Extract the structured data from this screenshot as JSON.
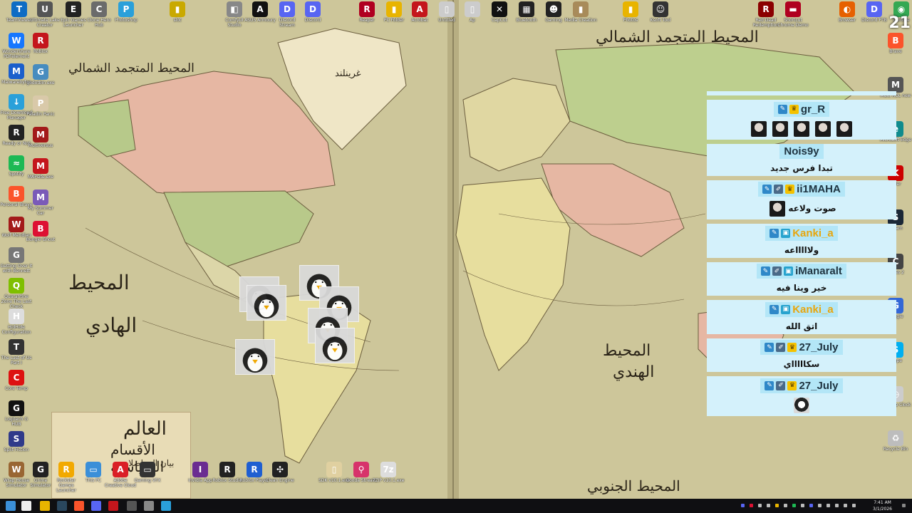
{
  "desktop": {
    "top_row": [
      {
        "label": "TeamViewer",
        "color": "#0e6cc4",
        "glyph": "T"
      },
      {
        "label": "Ultimate Lake Creator",
        "color": "#555555",
        "glyph": "U"
      },
      {
        "label": "Epic Games Launcher",
        "color": "#222222",
        "glyph": "E"
      },
      {
        "label": "Clone Hero Hub",
        "color": "#6b6b6b",
        "glyph": "C"
      },
      {
        "label": "Photoshop",
        "color": "#2aa0da",
        "glyph": "P"
      },
      {
        "label": "slot",
        "color": "#c9a900",
        "glyph": "▮"
      },
      {
        "label": "ComfyUI Studio",
        "color": "#888888",
        "glyph": "◧"
      },
      {
        "label": "ASUS Armoury",
        "color": "#111111",
        "glyph": "A"
      },
      {
        "label": "Discord Stream",
        "color": "#5865f2",
        "glyph": "D"
      },
      {
        "label": "Discord",
        "color": "#5865f2",
        "glyph": "D"
      },
      {
        "label": "Reaper",
        "color": "#b00020",
        "glyph": "R"
      },
      {
        "label": "PC Folder",
        "color": "#e8b400",
        "glyph": "▮"
      },
      {
        "label": "Acrobat",
        "color": "#c4161c",
        "glyph": "A"
      },
      {
        "label": "Untitled",
        "color": "#cccccc",
        "glyph": "▯"
      },
      {
        "label": "Ap",
        "color": "#cccccc",
        "glyph": "▯"
      },
      {
        "label": "CapCut",
        "color": "#111111",
        "glyph": "✕"
      },
      {
        "label": "Bluetooth",
        "color": "#222222",
        "glyph": "▦"
      },
      {
        "label": "Gaming",
        "color": "#222222",
        "glyph": "☻"
      },
      {
        "label": "Media Creation",
        "color": "#a88b5a",
        "glyph": "▮"
      },
      {
        "label": "Photos",
        "color": "#e8b400",
        "glyph": "▮"
      },
      {
        "label": "Ksoft Tool",
        "color": "#333333",
        "glyph": "☺"
      },
      {
        "label": "Red Dead Redemption",
        "color": "#8b0000",
        "glyph": "R"
      },
      {
        "label": "Shortcut Chrome Demo",
        "color": "#b00020",
        "glyph": "▬"
      },
      {
        "label": "Browser",
        "color": "#e66000",
        "glyph": "◐"
      },
      {
        "label": "Discord PTB",
        "color": "#5865f2",
        "glyph": "D"
      },
      {
        "label": "Chrome",
        "color": "#34a853",
        "glyph": "◉"
      }
    ],
    "left_col": [
      {
        "label": "Wondershare PDFelement",
        "color": "#1677ff",
        "glyph": "W"
      },
      {
        "label": "Malwarebytes",
        "color": "#1b5fcc",
        "glyph": "M"
      },
      {
        "label": "Free Download Manager",
        "color": "#2aa0da",
        "glyph": "↓"
      },
      {
        "label": "Ready or Not",
        "color": "#222222",
        "glyph": "R"
      },
      {
        "label": "Spotify",
        "color": "#1db954",
        "glyph": "≈"
      },
      {
        "label": "Personal Brave",
        "color": "#fb542b",
        "glyph": "B"
      },
      {
        "label": "Wolf Meridian",
        "color": "#a31a1a",
        "glyph": "W"
      },
      {
        "label": "Getting Over It with Bennett",
        "color": "#777777",
        "glyph": "G"
      },
      {
        "label": "Quarantine Zone The Last Check",
        "color": "#7fbf00",
        "glyph": "Q"
      },
      {
        "label": "HidHide Configuration",
        "color": "#dddddd",
        "glyph": "H"
      },
      {
        "label": "The Last of Us Part I",
        "color": "#333333",
        "glyph": "T"
      },
      {
        "label": "Core Temp",
        "color": "#d11",
        "glyph": "C"
      },
      {
        "label": "Logitech G HUB",
        "color": "#111111",
        "glyph": "G"
      },
      {
        "label": "Split Fiction",
        "color": "#2f3a8a",
        "glyph": "S"
      },
      {
        "label": "Wrap House Simulator",
        "color": "#996633",
        "glyph": "W"
      }
    ],
    "second_col": [
      {
        "label": "Roblox",
        "color": "#c4161c",
        "glyph": "R"
      },
      {
        "label": "godotbin.exe",
        "color": "#478cbf",
        "glyph": "G"
      },
      {
        "label": "Paladin Panic",
        "color": "#d9c9a9",
        "glyph": "P"
      },
      {
        "label": "Multiversus",
        "color": "#a31a1a",
        "glyph": "M"
      },
      {
        "label": "MAPsite.exe",
        "color": "#c4161c",
        "glyph": "M"
      },
      {
        "label": "My Summer Car",
        "color": "#7a5ab8",
        "glyph": "M"
      },
      {
        "label": "Bungie Ghost",
        "color": "#d13",
        "glyph": "B"
      }
    ],
    "bottom_row": [
      {
        "label": "Grime Simulator",
        "color": "#222222",
        "glyph": "G"
      },
      {
        "label": "Rockstar Games Launcher",
        "color": "#f2a900",
        "glyph": "R"
      },
      {
        "label": "This PC",
        "color": "#3b8fd8",
        "glyph": "▭"
      },
      {
        "label": "Adobe Creative Cloud",
        "color": "#da1f26",
        "glyph": "A"
      },
      {
        "label": "Gaming VFX",
        "color": "#333333",
        "glyph": "▭"
      },
      {
        "label": "Invidia App",
        "color": "#6a2c91",
        "glyph": "I"
      },
      {
        "label": "Roblox Studio",
        "color": "#222222",
        "glyph": "R"
      },
      {
        "label": "Roblox Player",
        "color": "#1f5fd1",
        "glyph": "R"
      },
      {
        "label": "Clean Engine",
        "color": "#222222",
        "glyph": "✣"
      },
      {
        "label": "SDK v10.1.exe",
        "color": "#e0d0a0",
        "glyph": "▯"
      },
      {
        "label": "Gooda Stream",
        "color": "#d7336b",
        "glyph": "⚲"
      },
      {
        "label": "7ZIP v10.1.exe",
        "color": "#dddddd",
        "glyph": "7z"
      }
    ],
    "right_col": [
      {
        "label": "Brave",
        "color": "#fb542b",
        "glyph": "B"
      },
      {
        "label": "Multi ROL new",
        "color": "#555555",
        "glyph": "M"
      },
      {
        "label": "Microsoft Edge",
        "color": "#0f8b8d",
        "glyph": "e"
      },
      {
        "label": "Killer",
        "color": "#cc0000",
        "glyph": "K"
      },
      {
        "label": "Steam",
        "color": "#1b2838",
        "glyph": "S"
      },
      {
        "label": "Chess 2",
        "color": "#444444",
        "glyph": "C"
      },
      {
        "label": "Google",
        "color": "#3367d6",
        "glyph": "G"
      },
      {
        "label": "Skype",
        "color": "#00aff0",
        "glyph": "S"
      },
      {
        "label": "Desktop Clock",
        "color": "#cccccc",
        "glyph": "◷"
      },
      {
        "label": "Recycle Bin",
        "color": "#bdbdbd",
        "glyph": "♻"
      }
    ]
  },
  "map": {
    "labels": [
      {
        "text": "المحيط المتجمد الشمالي"
      },
      {
        "text": "المحيط المتجمد الشمالي"
      },
      {
        "text": "المحيط"
      },
      {
        "text": "الهادي"
      },
      {
        "text": "المحيط"
      },
      {
        "text": "الهندي"
      },
      {
        "text": "المحيط الجنوبي"
      },
      {
        "text": "غرينلند"
      }
    ],
    "legend": {
      "title": "العالم",
      "subtitle": "الأقسام السياسية",
      "note": "بيان المواصلات"
    }
  },
  "chat": {
    "messages": [
      {
        "user": "gr_R",
        "name_style": "default",
        "badges": [
          "pen",
          "crown"
        ],
        "text": "",
        "emotes": [
          "face",
          "face",
          "face",
          "face",
          "face"
        ]
      },
      {
        "user": "Nois9y",
        "name_style": "default",
        "badges": [],
        "text": "تبدا فرس جديد",
        "emotes": []
      },
      {
        "user": "ii1MAHA",
        "name_style": "default",
        "badges": [
          "pen",
          "brush",
          "crown"
        ],
        "text": "صوت ولاعه",
        "emotes": [
          "face"
        ]
      },
      {
        "user": "Kanki_a",
        "name_style": "gold",
        "badges": [
          "pen",
          "game"
        ],
        "text": "ولاااااعه",
        "emotes": []
      },
      {
        "user": "iManaralt",
        "name_style": "default",
        "badges": [
          "pen",
          "brush",
          "game"
        ],
        "text": "خير وينا فيه",
        "emotes": []
      },
      {
        "user": "Kanki_a",
        "name_style": "gold",
        "badges": [
          "pen",
          "game"
        ],
        "text": "اتق الله",
        "emotes": []
      },
      {
        "user": "27_July",
        "name_style": "default",
        "badges": [
          "pen",
          "brush",
          "crown"
        ],
        "text": "سكاااااي",
        "emotes": []
      },
      {
        "user": "27_July",
        "name_style": "default",
        "badges": [
          "pen",
          "brush",
          "crown"
        ],
        "text": "",
        "emotes": [
          "pg"
        ]
      }
    ]
  },
  "overlay_count": "21",
  "taskbar": {
    "time": "7:41 AM",
    "date": "3/1/2026",
    "pinned": [
      {
        "name": "start-button",
        "color": "#3b8fd8"
      },
      {
        "name": "search-button",
        "color": "#eeeeee"
      },
      {
        "name": "file-explorer",
        "color": "#e8b400"
      },
      {
        "name": "steam",
        "color": "#2a475e"
      },
      {
        "name": "brave",
        "color": "#fb542b"
      },
      {
        "name": "discord",
        "color": "#5865f2"
      },
      {
        "name": "acrobat",
        "color": "#c4161c"
      },
      {
        "name": "obs",
        "color": "#555555"
      },
      {
        "name": "settings",
        "color": "#888888"
      },
      {
        "name": "photoshop",
        "color": "#2aa0da"
      }
    ]
  }
}
